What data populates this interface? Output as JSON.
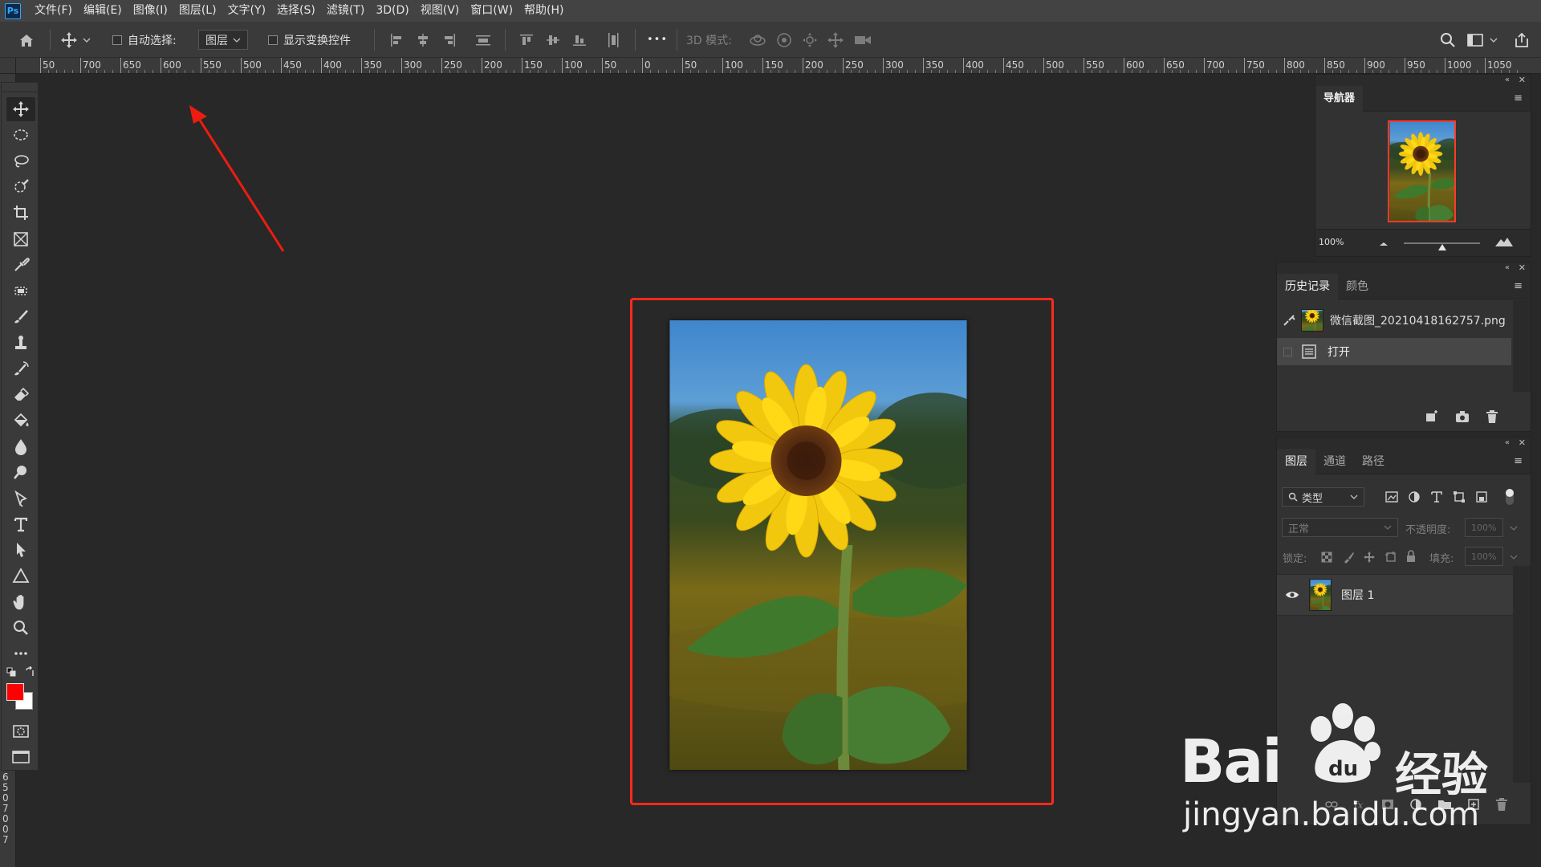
{
  "app": {
    "logo": "Ps"
  },
  "menu": [
    "文件(F)",
    "编辑(E)",
    "图像(I)",
    "图层(L)",
    "文字(Y)",
    "选择(S)",
    "滤镜(T)",
    "3D(D)",
    "视图(V)",
    "窗口(W)",
    "帮助(H)"
  ],
  "options": {
    "auto_select_label": "自动选择:",
    "auto_select_value": "图层",
    "show_transform_label": "显示变换控件",
    "more_label": "•••",
    "mode_3d_label": "3D 模式:"
  },
  "ruler": {
    "h_labels": [
      "50",
      "700",
      "650",
      "600",
      "550",
      "500",
      "450",
      "400",
      "350",
      "300",
      "250",
      "200",
      "150",
      "100",
      "50",
      "0",
      "50",
      "100",
      "150",
      "200",
      "250",
      "300",
      "350",
      "400",
      "450",
      "500",
      "550",
      "600",
      "650",
      "700",
      "750",
      "800",
      "850",
      "900",
      "950",
      "1000",
      "1050"
    ],
    "v_labels": [
      "6",
      "5",
      "0",
      "7",
      "0",
      "0",
      "7"
    ]
  },
  "tools": [
    "move-tool",
    "marquee-tool",
    "lasso-tool",
    "quick-select-tool",
    "crop-tool",
    "frame-tool",
    "eyedropper-tool",
    "healing-tool",
    "brush-tool",
    "stamp-tool",
    "history-brush-tool",
    "eraser-tool",
    "paint-bucket-tool",
    "blur-tool",
    "dodge-tool",
    "pen-tool",
    "type-tool",
    "path-select-tool",
    "shape-tool",
    "hand-tool",
    "zoom-tool",
    "more-tools"
  ],
  "colors": {
    "foreground": "#ff0000",
    "background": "#ffffff",
    "annotation": "#ff2a1a"
  },
  "navigator": {
    "tab": "导航器",
    "zoom": "100%",
    "zoom_fraction": 0.5
  },
  "history": {
    "tabs": [
      "历史记录",
      "颜色"
    ],
    "items": [
      {
        "label": "微信截图_20210418162757.png",
        "type": "snapshot"
      },
      {
        "label": "打开",
        "type": "step",
        "selected": true
      }
    ]
  },
  "layers": {
    "tabs": [
      "图层",
      "通道",
      "路径"
    ],
    "filter_kind": "类型",
    "blend_mode": "正常",
    "opacity_label": "不透明度:",
    "opacity_value": "100%",
    "lock_label": "锁定:",
    "fill_label": "填充:",
    "fill_value": "100%",
    "items": [
      {
        "name": "图层 1",
        "visible": true
      }
    ]
  },
  "watermark": {
    "brand": "Bai",
    "brand_suffix": "经验",
    "url": "jingyan.baidu.com"
  }
}
